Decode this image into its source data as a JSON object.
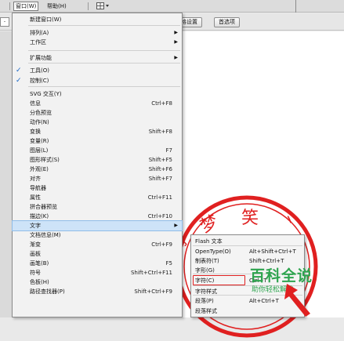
{
  "menubar": {
    "window_label": "窗口(W)",
    "help_label": "帮助(H)"
  },
  "toolbar": {
    "combo_value": "-",
    "btn1_label": "格设置",
    "btn2_label": "首选项"
  },
  "menu": {
    "items": [
      {
        "label": "新建窗口(W)",
        "shortcut": "",
        "submenu": false,
        "checked": false
      },
      {
        "label": "排列(A)",
        "shortcut": "",
        "submenu": true,
        "checked": false
      },
      {
        "label": "工作区",
        "shortcut": "",
        "submenu": true,
        "checked": false
      },
      {
        "label": "扩展功能",
        "shortcut": "",
        "submenu": true,
        "checked": false
      },
      {
        "label": "工具(O)",
        "shortcut": "",
        "submenu": false,
        "checked": true
      },
      {
        "label": "控制(C)",
        "shortcut": "",
        "submenu": false,
        "checked": true
      },
      {
        "label": "SVG 交互(Y)",
        "shortcut": "",
        "submenu": false,
        "checked": false
      },
      {
        "label": "信息",
        "shortcut": "Ctrl+F8",
        "submenu": false,
        "checked": false
      },
      {
        "label": "分色预览",
        "shortcut": "",
        "submenu": false,
        "checked": false
      },
      {
        "label": "动作(N)",
        "shortcut": "",
        "submenu": false,
        "checked": false
      },
      {
        "label": "变换",
        "shortcut": "Shift+F8",
        "submenu": false,
        "checked": false
      },
      {
        "label": "变量(R)",
        "shortcut": "",
        "submenu": false,
        "checked": false
      },
      {
        "label": "图层(L)",
        "shortcut": "F7",
        "submenu": false,
        "checked": false
      },
      {
        "label": "图形样式(S)",
        "shortcut": "Shift+F5",
        "submenu": false,
        "checked": false
      },
      {
        "label": "外观(E)",
        "shortcut": "Shift+F6",
        "submenu": false,
        "checked": false
      },
      {
        "label": "对齐",
        "shortcut": "Shift+F7",
        "submenu": false,
        "checked": false
      },
      {
        "label": "导航器",
        "shortcut": "",
        "submenu": false,
        "checked": false
      },
      {
        "label": "属性",
        "shortcut": "Ctrl+F11",
        "submenu": false,
        "checked": false
      },
      {
        "label": "拼合器预览",
        "shortcut": "",
        "submenu": false,
        "checked": false
      },
      {
        "label": "描边(K)",
        "shortcut": "Ctrl+F10",
        "submenu": false,
        "checked": false
      },
      {
        "label": "文字",
        "shortcut": "",
        "submenu": true,
        "checked": false
      },
      {
        "label": "文档信息(M)",
        "shortcut": "",
        "submenu": false,
        "checked": false
      },
      {
        "label": "渐变",
        "shortcut": "Ctrl+F9",
        "submenu": false,
        "checked": false
      },
      {
        "label": "画板",
        "shortcut": "",
        "submenu": false,
        "checked": false
      },
      {
        "label": "画笔(B)",
        "shortcut": "F5",
        "submenu": false,
        "checked": false
      },
      {
        "label": "符号",
        "shortcut": "Shift+Ctrl+F11",
        "submenu": false,
        "checked": false
      },
      {
        "label": "色板(H)",
        "shortcut": "",
        "submenu": false,
        "checked": false
      },
      {
        "label": "路径查找器(P)",
        "shortcut": "Shift+Ctrl+F9",
        "submenu": false,
        "checked": false
      }
    ]
  },
  "submenu": {
    "items": [
      {
        "label": "Flash 文本",
        "shortcut": ""
      },
      {
        "label": "OpenType(O)",
        "shortcut": "Alt+Shift+Ctrl+T"
      },
      {
        "label": "制表符(T)",
        "shortcut": "Shift+Ctrl+T"
      },
      {
        "label": "字形(G)",
        "shortcut": ""
      },
      {
        "label": "字符(C)",
        "shortcut": "Ctrl+T"
      },
      {
        "label": "字符样式",
        "shortcut": ""
      },
      {
        "label": "段落(P)",
        "shortcut": "Alt+Ctrl+T"
      },
      {
        "label": "段落样式",
        "shortcut": ""
      }
    ]
  },
  "stamp": {
    "chars": [
      "梦",
      "笑"
    ],
    "color": "#e02020"
  },
  "watermark": {
    "title": "百科全说",
    "subtitle": "助你轻松解决",
    "color": "#2ea44f"
  },
  "colors": {
    "highlight": "#cde3f8",
    "check": "#1565c8",
    "annotation": "#e02020"
  }
}
